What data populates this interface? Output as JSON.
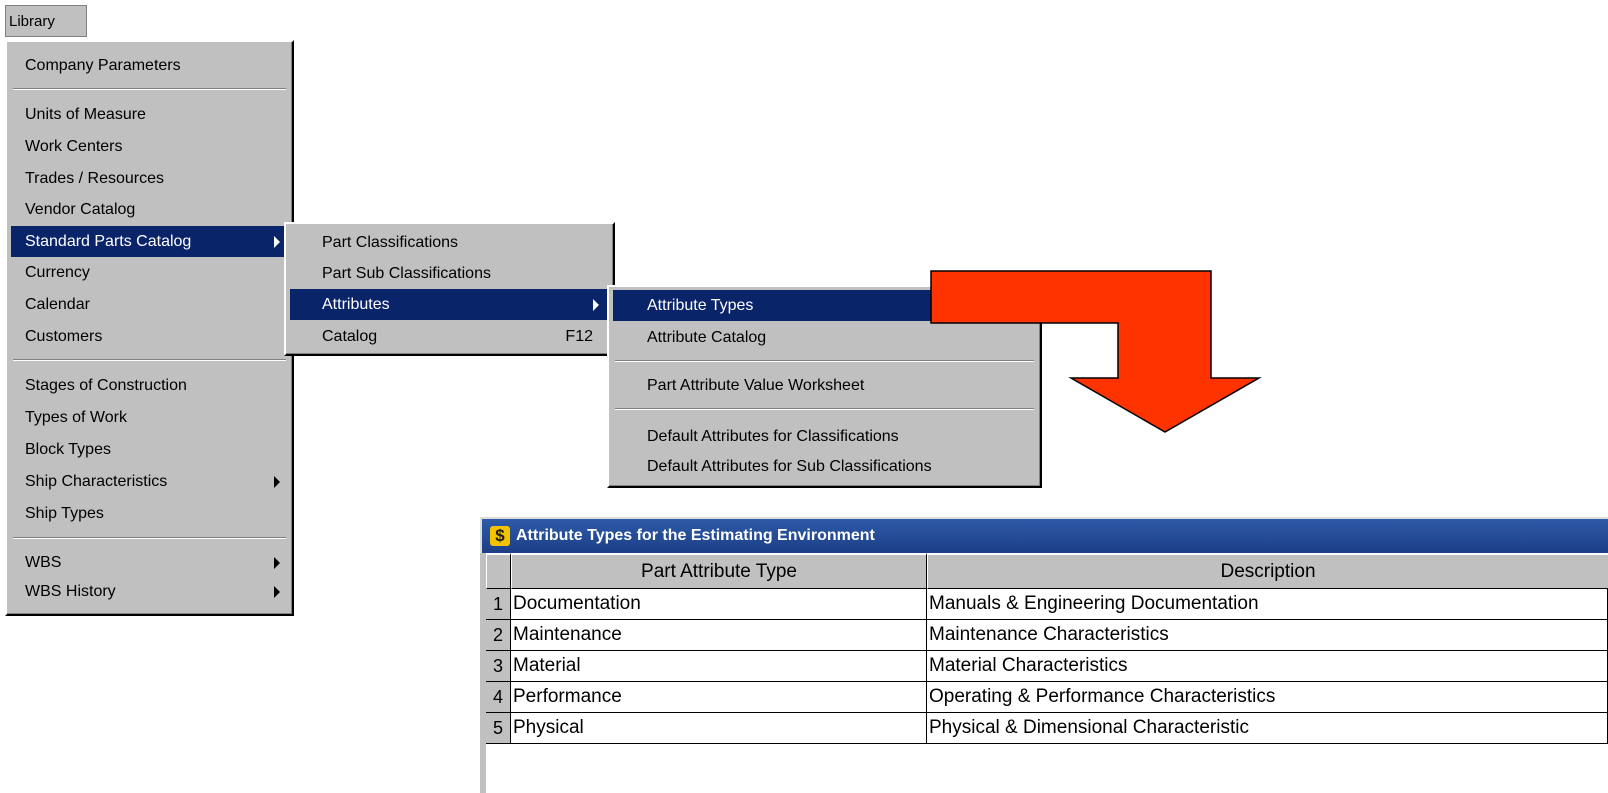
{
  "menubar": {
    "library_label": "Library"
  },
  "library_menu": {
    "items": [
      {
        "label": "Company Parameters"
      },
      {
        "label": "Units of Measure"
      },
      {
        "label": "Work Centers"
      },
      {
        "label": "Trades / Resources"
      },
      {
        "label": "Vendor Catalog"
      },
      {
        "label": "Standard Parts Catalog",
        "submenu": true,
        "active": true
      },
      {
        "label": "Currency"
      },
      {
        "label": "Calendar"
      },
      {
        "label": "Customers"
      },
      {
        "label": "Stages of Construction"
      },
      {
        "label": "Types of Work"
      },
      {
        "label": "Block Types"
      },
      {
        "label": "Ship Characteristics",
        "submenu": true
      },
      {
        "label": "Ship Types"
      },
      {
        "label": "WBS",
        "submenu": true
      },
      {
        "label": "WBS History",
        "submenu": true
      }
    ]
  },
  "parts_menu": {
    "items": [
      {
        "label": "Part Classifications"
      },
      {
        "label": "Part Sub Classifications"
      },
      {
        "label": "Attributes",
        "submenu": true,
        "active": true
      },
      {
        "label": "Catalog",
        "shortcut": "F12"
      }
    ]
  },
  "attributes_menu": {
    "items": [
      {
        "label": "Attribute Types",
        "active": true
      },
      {
        "label": "Attribute Catalog"
      },
      {
        "label": "Part Attribute Value Worksheet"
      },
      {
        "label": "Default Attributes for Classifications"
      },
      {
        "label": "Default Attributes for Sub Classifications"
      }
    ]
  },
  "callout": {
    "color": "#ff3300",
    "icon": "arrow-down-right-icon"
  },
  "window": {
    "title": "Attribute Types for the Estimating Environment",
    "icon": "dollar-icon",
    "columns": [
      "Part Attribute Type",
      "Description"
    ],
    "rows": [
      {
        "num": "1",
        "type": "Documentation",
        "description": "Manuals & Engineering Documentation"
      },
      {
        "num": "2",
        "type": "Maintenance",
        "description": "Maintenance Characteristics"
      },
      {
        "num": "3",
        "type": "Material",
        "description": "Material Characteristics"
      },
      {
        "num": "4",
        "type": "Performance",
        "description": "Operating & Performance Characteristics"
      },
      {
        "num": "5",
        "type": "Physical",
        "description": "Physical & Dimensional Characteristic"
      }
    ]
  }
}
